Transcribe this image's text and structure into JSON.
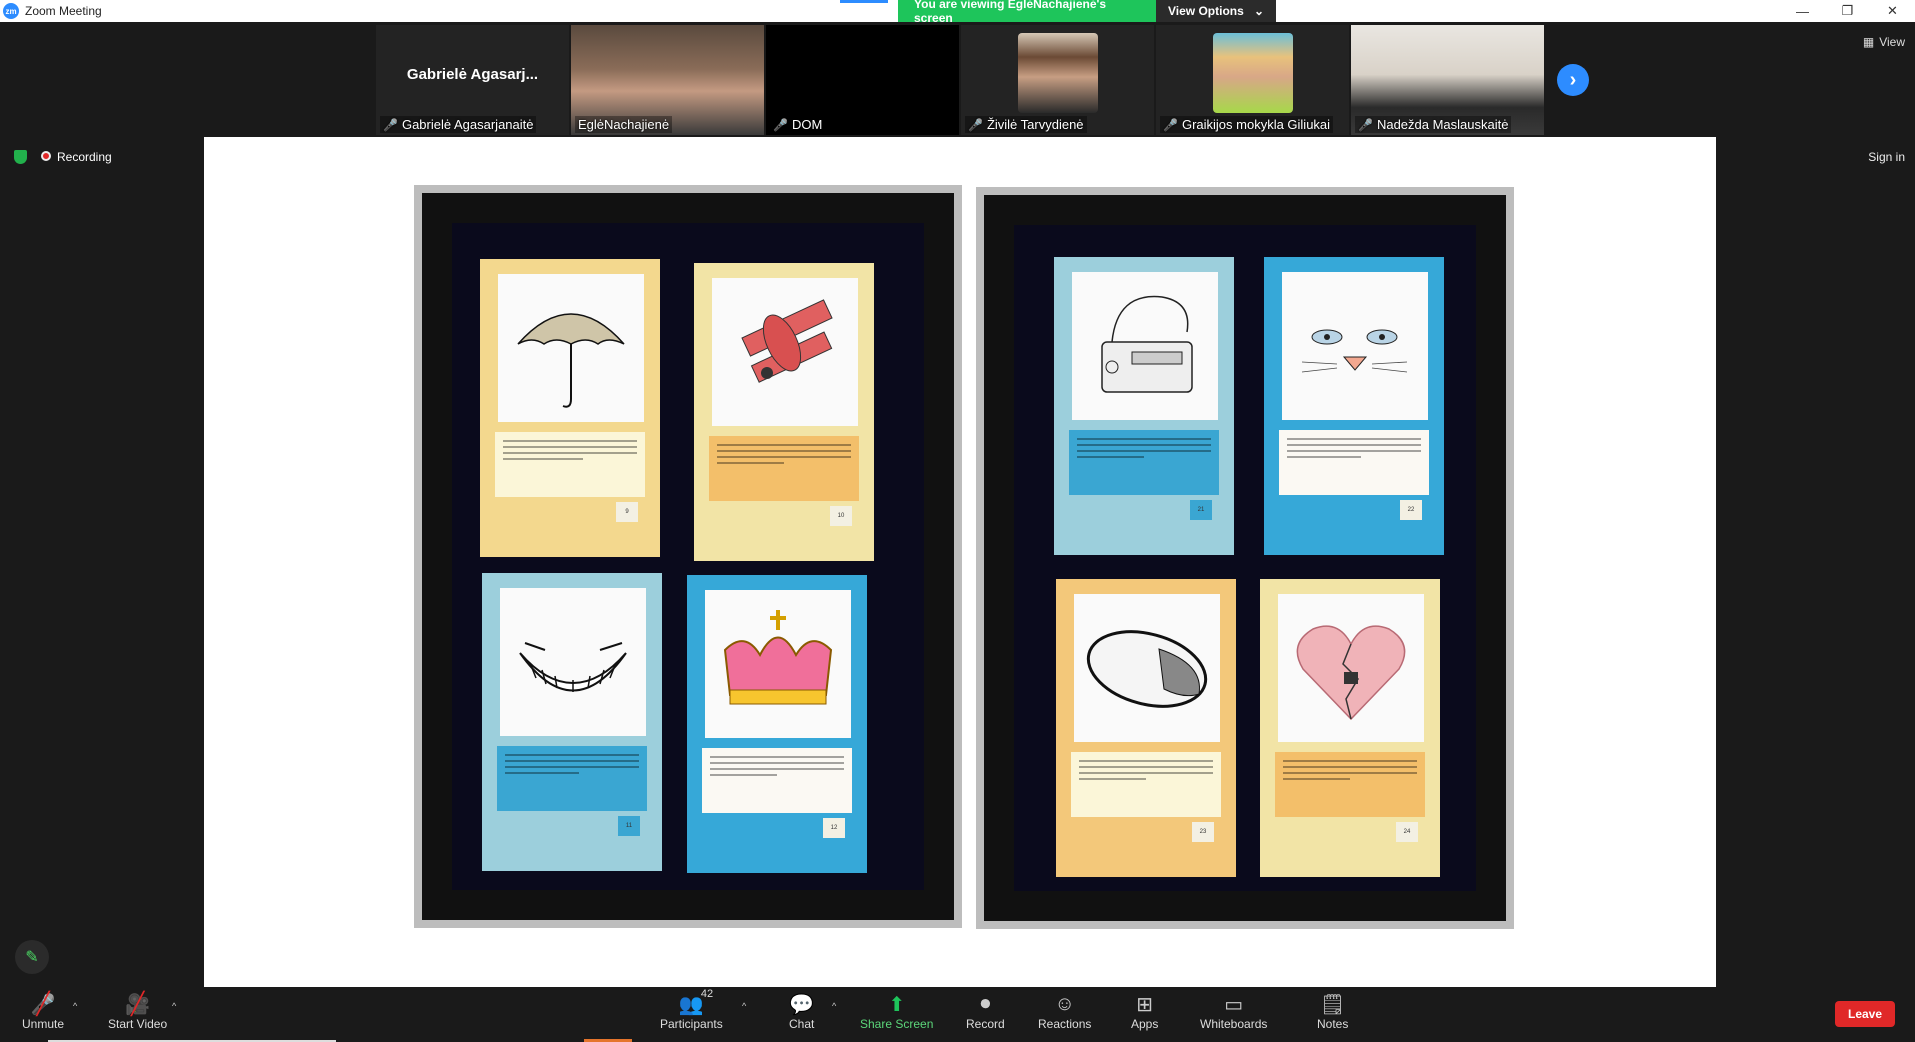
{
  "window": {
    "title": "Zoom Meeting",
    "minimize": "—",
    "restore": "❐",
    "close": "✕"
  },
  "banner": {
    "viewing": "You are viewing EglėNachajienė's screen",
    "view_options": "View Options",
    "chevron": "⌄"
  },
  "gallery": {
    "tiles": [
      {
        "big_name": "Gabrielė Agasarj...",
        "label": "Gabrielė Agasarjanaitė"
      },
      {
        "label": "EglėNachajienė"
      },
      {
        "label": "DOM"
      },
      {
        "label": "Živilė Tarvydienė"
      },
      {
        "label": "Graikijos mokykla Giliukai"
      },
      {
        "label": "Nadežda Maslauskaitė"
      }
    ],
    "next": "›",
    "view_label": "View"
  },
  "status": {
    "recording": "Recording",
    "sign_in": "Sign in"
  },
  "toolbar": {
    "unmute": "Unmute",
    "start_video": "Start Video",
    "participants": "Participants",
    "participants_count": "42",
    "chat": "Chat",
    "share_screen": "Share Screen",
    "record": "Record",
    "reactions": "Reactions",
    "apps": "Apps",
    "whiteboards": "Whiteboards",
    "notes": "Notes",
    "leave": "Leave"
  },
  "colors": {
    "zoom_blue": "#2d8cff",
    "viewing_green": "#1ec55b",
    "leave_red": "#e02828",
    "card_yellow": "#f3d88e",
    "card_pale_yellow": "#f2e4a6",
    "card_light_blue": "#9ccfdc",
    "card_blue": "#36a8d8"
  }
}
